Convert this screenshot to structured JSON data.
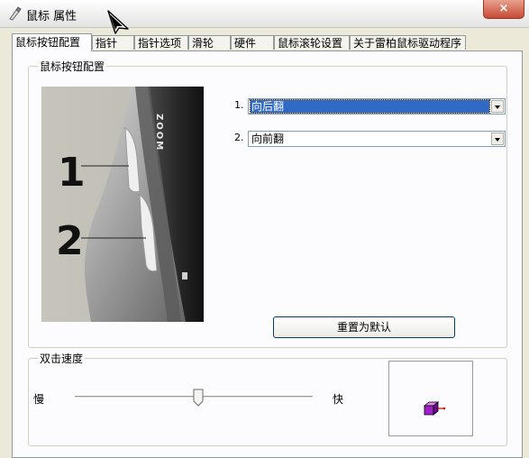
{
  "window": {
    "title": "鼠标 属性",
    "close_label": "×"
  },
  "tabs": [
    {
      "label": "鼠标按钮配置",
      "active": true
    },
    {
      "label": "指针"
    },
    {
      "label": "指针选项"
    },
    {
      "label": "滑轮"
    },
    {
      "label": "硬件"
    },
    {
      "label": "鼠标滚轮设置"
    },
    {
      "label": "关于雷柏鼠标驱动程序"
    }
  ],
  "button_config": {
    "group_label": "鼠标按钮配置",
    "image_labels": {
      "callout1": "1",
      "callout2": "2",
      "zoom": "ZOOM"
    },
    "button1": {
      "label": "1.",
      "selected": "向后翻"
    },
    "button2": {
      "label": "2.",
      "selected": "向前翻"
    },
    "reset_label": "重置为默认"
  },
  "double_click": {
    "group_label": "双击速度",
    "slow_label": "慢",
    "fast_label": "快",
    "speed_fraction": 0.52
  },
  "icons": {
    "window": "mouse-window-icon",
    "cursor": "arrow-cursor-icon",
    "test": "purple-cube-test-icon"
  }
}
